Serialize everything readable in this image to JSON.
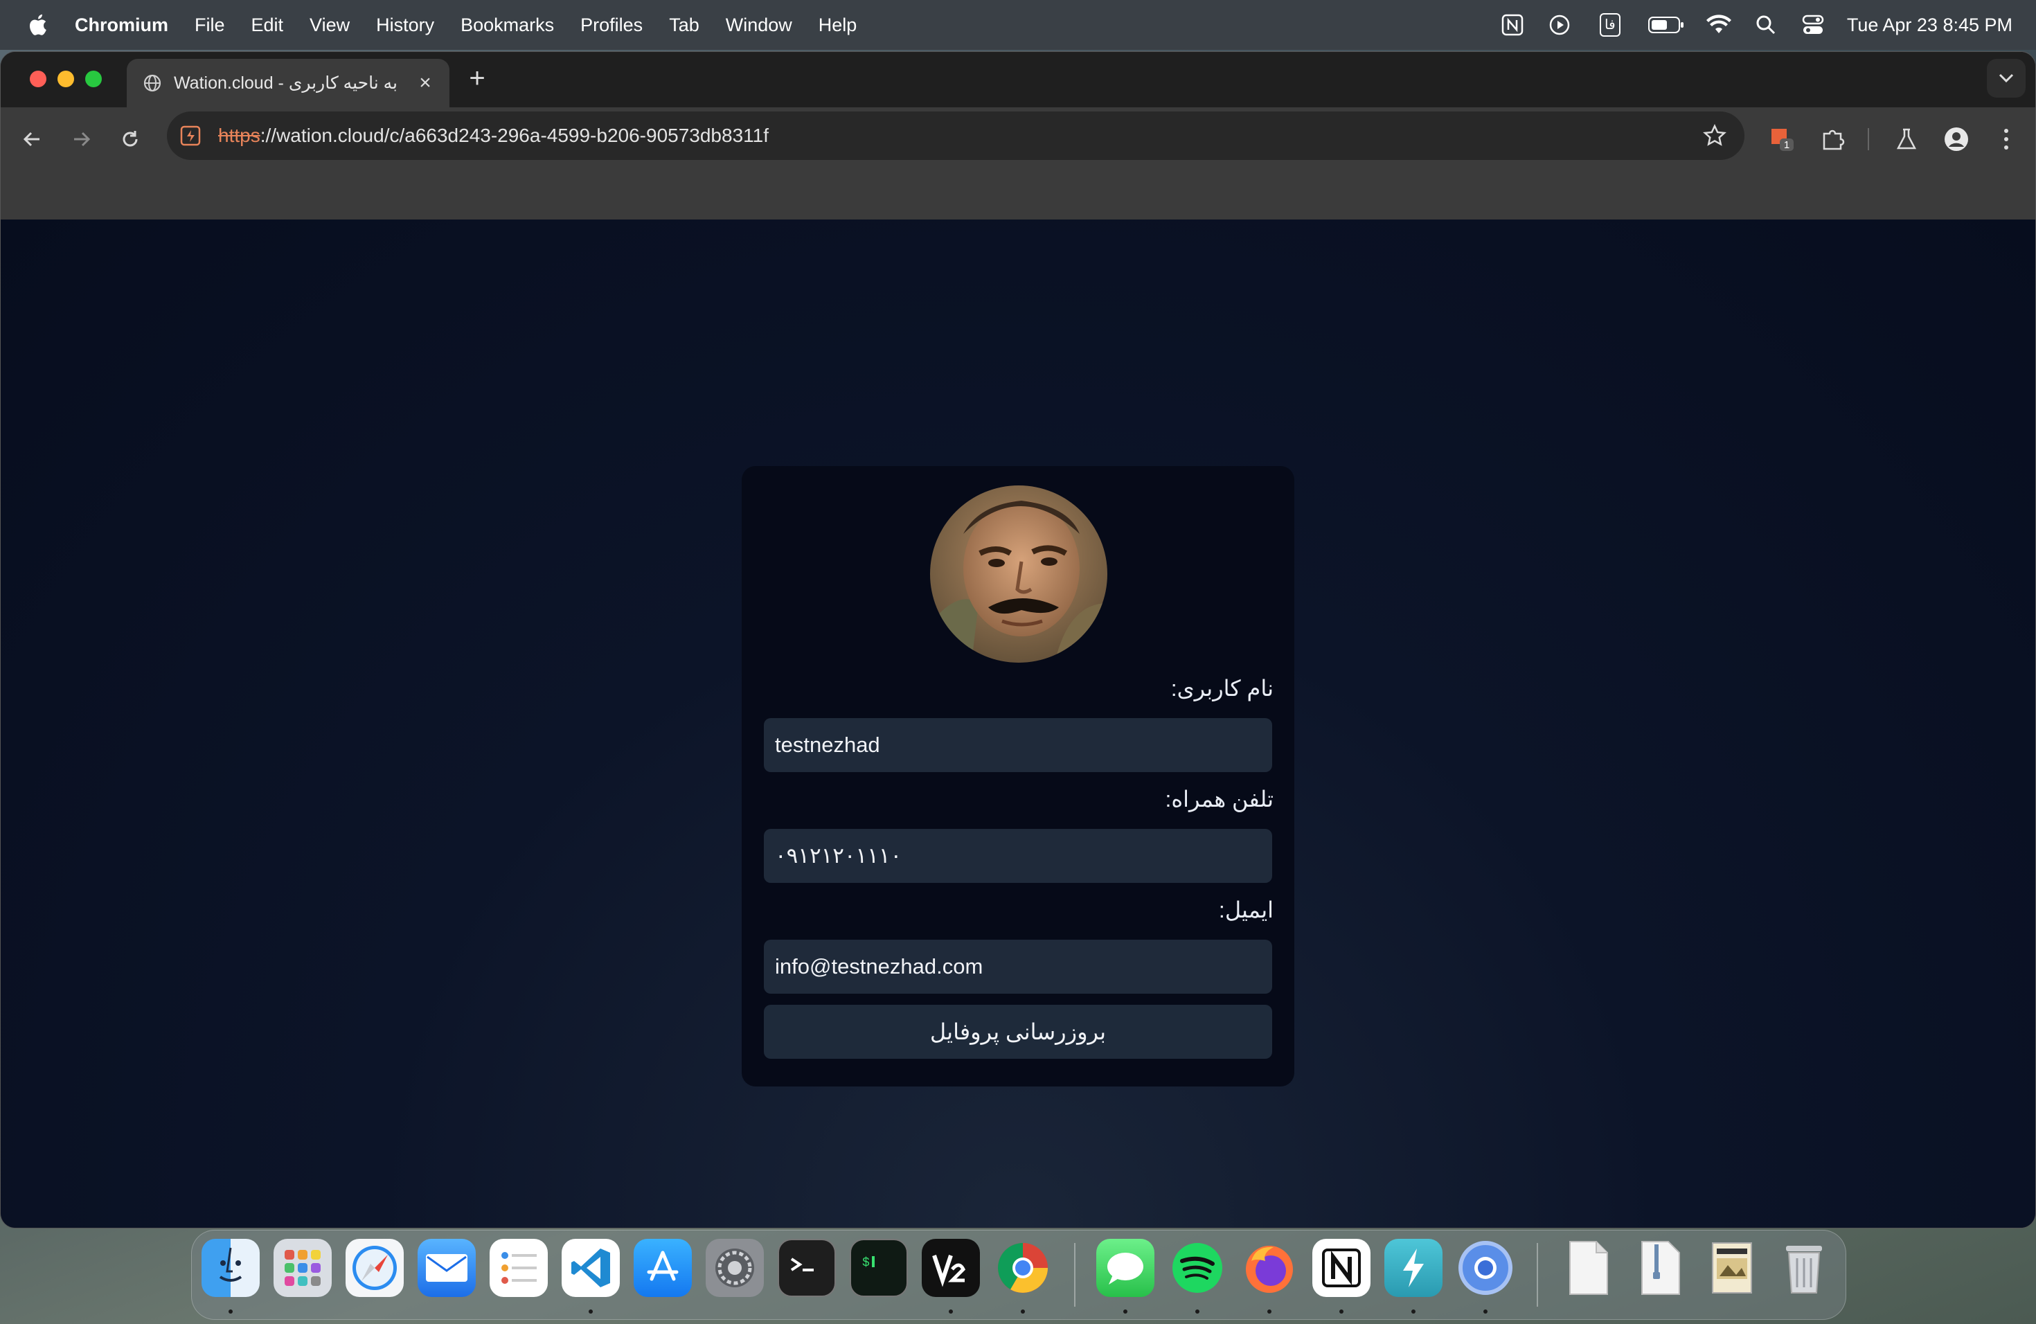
{
  "menubar": {
    "app_name": "Chromium",
    "items": [
      "File",
      "Edit",
      "View",
      "History",
      "Bookmarks",
      "Profiles",
      "Tab",
      "Window",
      "Help"
    ],
    "input_source": "فا",
    "clock": "Tue Apr 23  8:45 PM"
  },
  "browser": {
    "tab_title": "Wation.cloud - به ناحیه کاربری",
    "url_scheme": "https",
    "url_rest": "://wation.cloud/c/a663d243-296a-4599-b206-90573db8311f",
    "extension_badge": "1"
  },
  "profile_form": {
    "username_label": "نام کاربری:",
    "username_value": "testnezhad",
    "phone_label": "تلفن همراه:",
    "phone_value": "۰۹۱۲۱۲۰۱۱۱۰",
    "email_label": "ایمیل:",
    "email_value": "info@testnezhad.com",
    "submit_label": "بروزرسانی پروفایل"
  },
  "dock": {
    "apps": [
      "finder",
      "launchpad",
      "safari",
      "mail",
      "reminders",
      "vscode",
      "app-store",
      "system-settings",
      "terminal",
      "iterm",
      "v2box",
      "chrome",
      "messages",
      "spotify",
      "firefox",
      "notion",
      "bolt",
      "chromium",
      "document",
      "zip-archive",
      "preview-image",
      "trash"
    ]
  },
  "colors": {
    "page_bg": "#0b1224",
    "card_bg": "#060a18",
    "field_bg": "#1f2a3a",
    "url_scheme": "#e8845a"
  }
}
